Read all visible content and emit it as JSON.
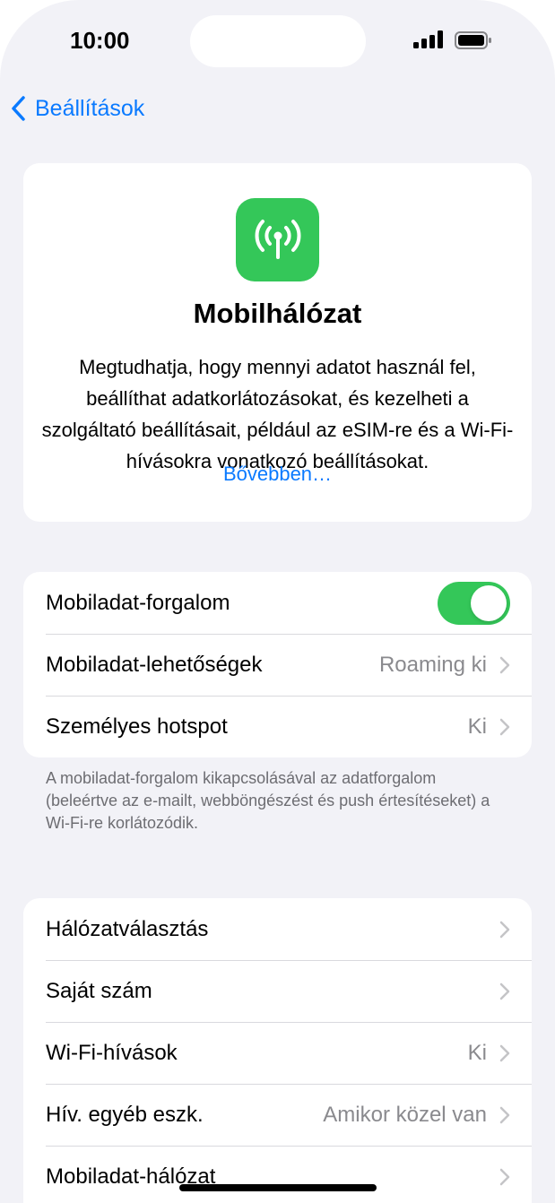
{
  "status_bar": {
    "time": "10:00"
  },
  "nav": {
    "back_label": "Beállítások"
  },
  "info_card": {
    "title": "Mobilhálózat",
    "description": "Megtudhatja, hogy mennyi adatot használ fel, beállíthat adatkorlátozásokat, és kezelheti a szolgáltató beállításait, például az eSIM-re és a Wi-Fi-hívásokra vonatkozó beállításokat.",
    "link": "Bővebben…",
    "icon": "antenna-icon"
  },
  "group1": {
    "rows": [
      {
        "label": "Mobiladat-forgalom",
        "toggle_on": true
      },
      {
        "label": "Mobiladat-lehetőségek",
        "value": "Roaming ki"
      },
      {
        "label": "Személyes hotspot",
        "value": "Ki"
      }
    ],
    "footer": "A mobiladat-forgalom kikapcsolásával az adatforgalom (beleértve az e-mailt, webböngészést és push értesítéseket) a Wi-Fi-re korlátozódik."
  },
  "group2": {
    "rows": [
      {
        "label": "Hálózatválasztás",
        "value": ""
      },
      {
        "label": "Saját szám",
        "value": ""
      },
      {
        "label": "Wi-Fi-hívások",
        "value": "Ki"
      },
      {
        "label": "Hív. egyéb eszk.",
        "value": "Amikor közel van"
      },
      {
        "label": "Mobiladat-hálózat",
        "value": ""
      }
    ]
  },
  "colors": {
    "accent": "#0a7aff",
    "toggle_on": "#34c759",
    "background": "#f2f2f7"
  }
}
